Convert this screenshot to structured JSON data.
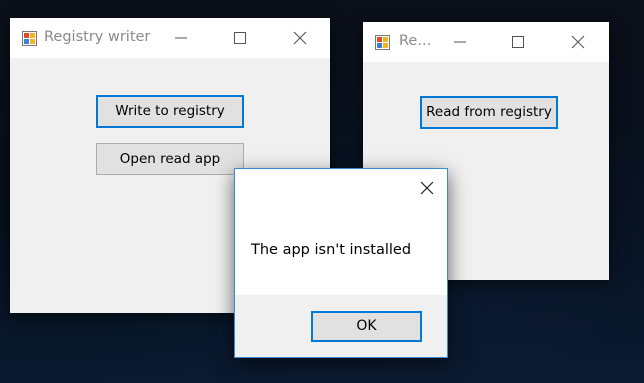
{
  "writer_window": {
    "title": "Registry writer",
    "icon": "windows-forms-app-icon",
    "controls": {
      "minimize": "minimize-icon",
      "maximize": "maximize-icon",
      "close": "close-icon"
    },
    "buttons": {
      "write": "Write to registry",
      "open_read": "Open read app"
    }
  },
  "reader_window": {
    "title": "Re...",
    "icon": "windows-forms-app-icon",
    "controls": {
      "minimize": "minimize-icon",
      "maximize": "maximize-icon",
      "close": "close-icon"
    },
    "buttons": {
      "read": "Read from registry"
    }
  },
  "message_box": {
    "message": "The app isn't installed",
    "ok_label": "OK",
    "close_icon": "close-icon"
  },
  "colors": {
    "accent": "#0078d7",
    "window_bg": "#f0f0f0",
    "titlebar_bg": "#ffffff",
    "title_text": "#8a8a8a",
    "button_bg": "#e1e1e1",
    "desktop": "#0a0e17"
  }
}
